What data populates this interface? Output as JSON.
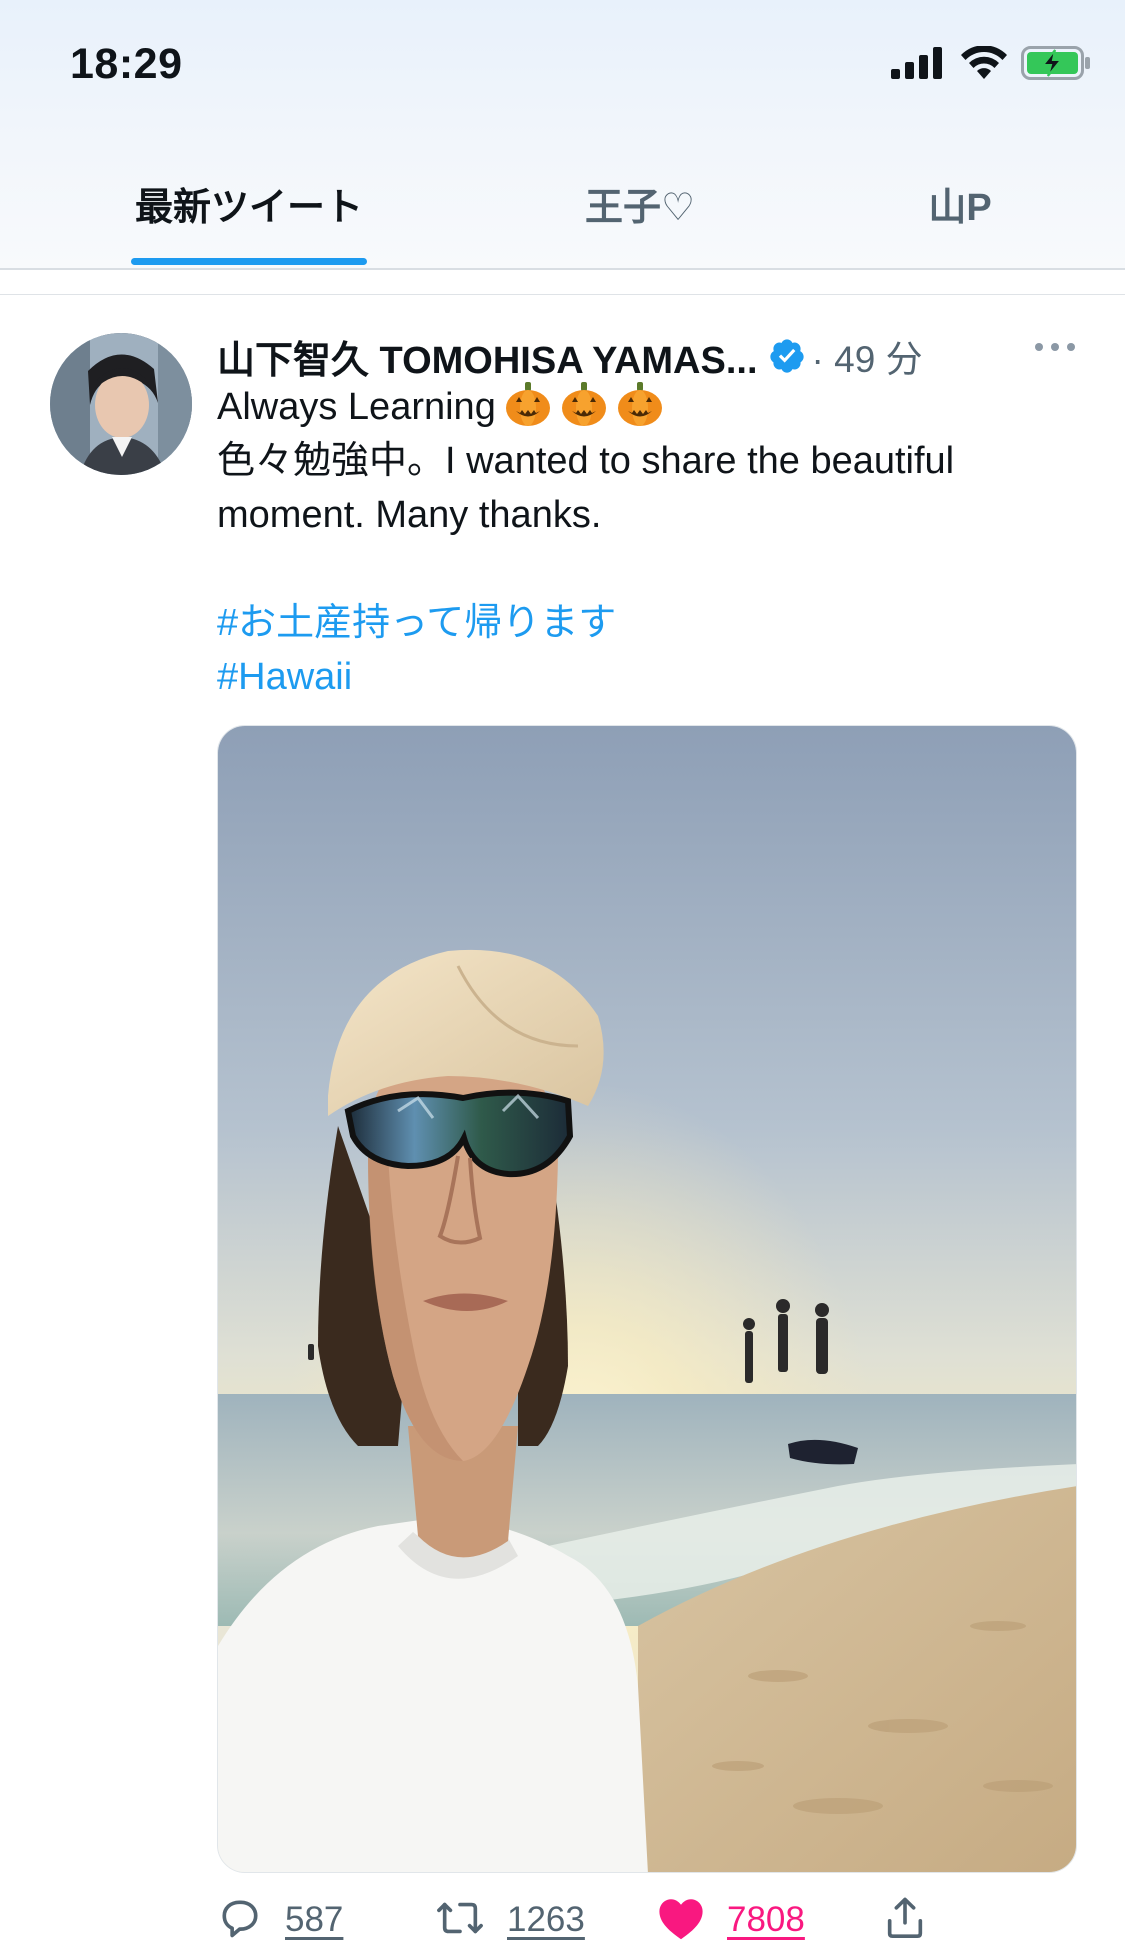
{
  "status_bar": {
    "time": "18:29",
    "icons": [
      "signal-icon",
      "wifi-icon",
      "battery-charging-icon"
    ]
  },
  "tabs": [
    {
      "label": "最新ツイート",
      "active": true
    },
    {
      "label": "王子♡",
      "active": false
    },
    {
      "label": "山P",
      "active": false
    }
  ],
  "tweet": {
    "display_name": "山下智久 TOMOHISA YAMAS...",
    "verified": true,
    "time": "· 49 分",
    "text_lines": [
      "Always Learning",
      "色々勉強中。I wanted to share the beautiful",
      "moment. Many thanks."
    ],
    "emoji": [
      "pumpkin-emoji",
      "pumpkin-emoji",
      "pumpkin-emoji"
    ],
    "hashtags": [
      "#お土産持って帰ります",
      "#Hawaii"
    ],
    "media": {
      "type": "photo",
      "alt": "beach-selfie-photo"
    },
    "actions": {
      "replies": "587",
      "retweets": "1263",
      "likes": "7808",
      "liked": true
    }
  },
  "colors": {
    "accent": "#1d9bf0",
    "like": "#f91880",
    "muted": "#536471",
    "battery": "#34c759"
  }
}
